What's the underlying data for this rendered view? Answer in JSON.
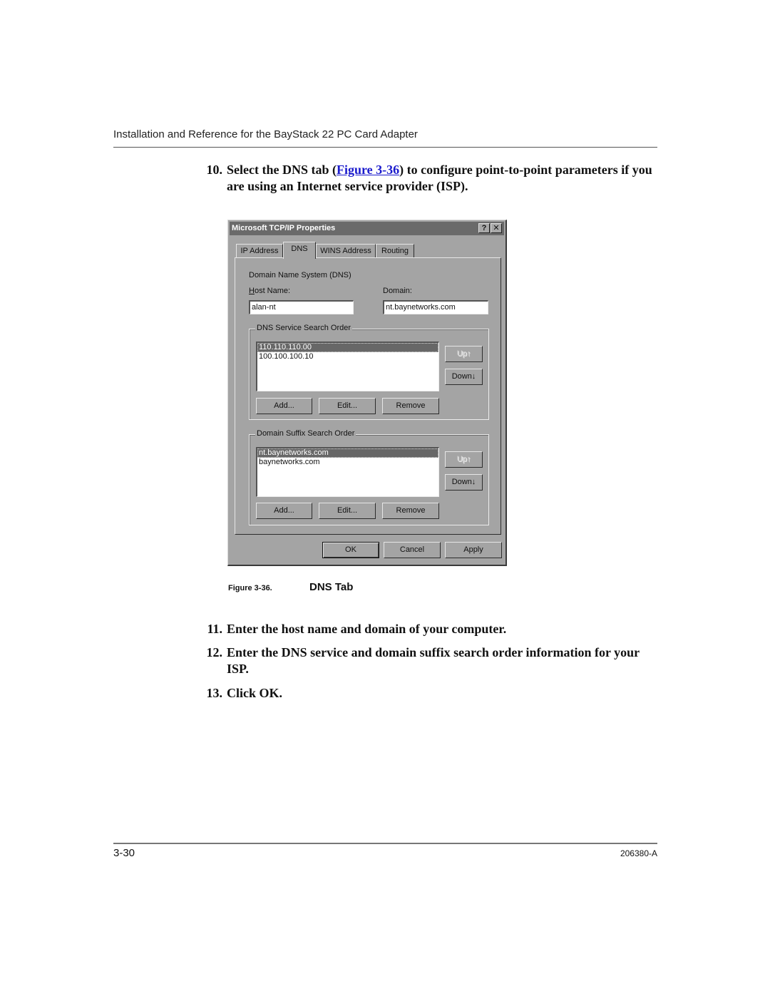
{
  "header": {
    "title": "Installation and Reference for the BayStack 22 PC Card Adapter"
  },
  "steps": [
    {
      "num": "10.",
      "before_link": "Select the DNS tab (",
      "link": "Figure 3-36",
      "after_link": ") to configure point-to-point parameters if you are using an Internet service provider (ISP)."
    },
    {
      "num": "11.",
      "text": "Enter the host name and domain of your computer."
    },
    {
      "num": "12.",
      "text": "Enter the DNS service and domain suffix search order information for your ISP."
    },
    {
      "num": "13.",
      "text": "Click OK."
    }
  ],
  "figure": {
    "label": "Figure 3-36.",
    "title": "DNS Tab"
  },
  "dialog": {
    "title": "Microsoft TCP/IP Properties",
    "help_button": "?",
    "close_button": "✕",
    "tabs": [
      {
        "label": "IP Address",
        "active": false
      },
      {
        "label": "DNS",
        "active": true
      },
      {
        "label": "WINS Address",
        "active": false
      },
      {
        "label": "Routing",
        "active": false
      }
    ],
    "dns_heading": "Domain Name System (DNS)",
    "host_name_label": "Host Name:",
    "host_name_value": "alan-nt",
    "domain_label": "Domain:",
    "domain_value": "nt.baynetworks.com",
    "dns_service": {
      "label": "DNS Service Search Order",
      "items": [
        "110.110.110.00",
        "100.100.100.10"
      ],
      "selected_index": 0,
      "up": "Up↑",
      "down": "Down↓",
      "add": "Add...",
      "edit": "Edit...",
      "remove": "Remove"
    },
    "domain_suffix": {
      "label": "Domain Suffix Search Order",
      "items": [
        "nt.baynetworks.com",
        "baynetworks.com"
      ],
      "selected_index": 0,
      "up": "Up↑",
      "down": "Down↓",
      "add": "Add...",
      "edit": "Edit...",
      "remove": "Remove"
    },
    "ok": "OK",
    "cancel": "Cancel",
    "apply": "Apply"
  },
  "footer": {
    "page_number": "3-30",
    "doc_id": "206380-A"
  }
}
